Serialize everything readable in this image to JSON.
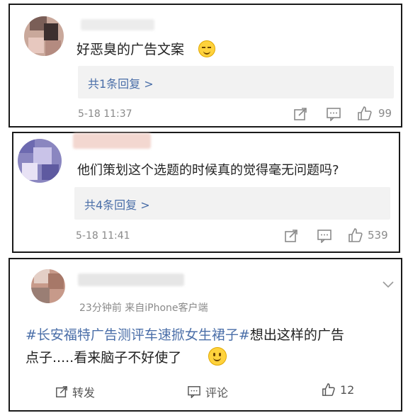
{
  "comments": [
    {
      "text": "好恶臭的广告文案",
      "reply_label": "共1条回复 >",
      "time": "5-18 11:37",
      "likes": "99"
    },
    {
      "text": "他们策划这个选题的时候真的觉得毫无问题吗?",
      "reply_label": "共4条回复 >",
      "time": "5-18 11:41",
      "likes": "539"
    }
  ],
  "post": {
    "meta": "23分钟前  来自iPhone客户端",
    "hashtag": "#长安福特广告测评车速掀女生裙子#",
    "text_after": "想出这样的广告",
    "text_line2": "点子.....看来脑子不好使了",
    "repost_label": "转发",
    "comment_label": "评论",
    "like_count": "12"
  },
  "colors": {
    "link": "#4a6ea8",
    "muted": "#8a8a8a",
    "reply_bg": "#f2f2f2"
  }
}
